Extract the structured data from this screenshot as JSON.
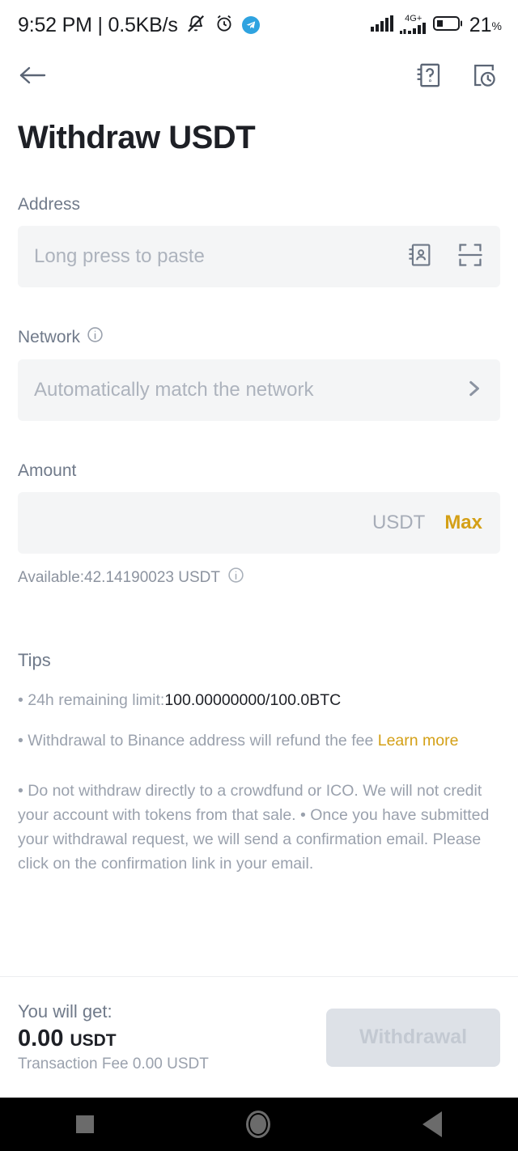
{
  "status_bar": {
    "clock_text": "9:52 PM | 0.5KB/s",
    "icons": [
      "mute-bell-icon",
      "alarm-clock-icon",
      "telegram-icon"
    ],
    "network_label": "4G+",
    "battery_percent": "21",
    "battery_percent_symbol": "%"
  },
  "nav_bar": {
    "back_icon": "back-arrow-icon",
    "help_icon": "help-book-icon",
    "history_icon": "withdraw-history-icon"
  },
  "header": {
    "title": "Withdraw USDT"
  },
  "address": {
    "label": "Address",
    "placeholder": "Long press to paste",
    "value": "",
    "contacts_icon": "address-book-icon",
    "scan_icon": "qr-scan-icon"
  },
  "network": {
    "label": "Network",
    "info_icon": "info-icon",
    "placeholder": "Automatically match the network",
    "value": "",
    "chevron_icon": "chevron-right-icon"
  },
  "amount": {
    "label": "Amount",
    "value": "",
    "unit": "USDT",
    "max_label": "Max",
    "available_text": "Available:42.14190023 USDT",
    "available_info_icon": "info-icon"
  },
  "tips": {
    "title": "Tips",
    "limit_prefix": "• 24h remaining limit:",
    "limit_value": "100.00000000/100.0BTC",
    "refund_text": "• Withdrawal to Binance address will refund the fee ",
    "refund_link": "Learn more",
    "paragraph": "• Do not withdraw directly to a crowdfund or ICO. We will not credit your account with tokens from that sale. • Once you have submitted your withdrawal request, we will send a confirmation email. Please click on the confirmation link in your email."
  },
  "bottom_bar": {
    "get_label": "You will get:",
    "get_amount": "0.00",
    "get_unit": "USDT",
    "fee_label": "Transaction Fee",
    "fee_value": "0.00 USDT",
    "withdraw_button": "Withdrawal"
  },
  "android_nav": {
    "recents_icon": "recents-square-icon",
    "home_icon": "home-circle-icon",
    "back_icon": "back-triangle-icon"
  },
  "colors": {
    "accent_gold": "#d4a017",
    "text_primary": "#1e2026",
    "text_secondary": "#707a8a",
    "field_bg": "#f4f5f6",
    "disabled_btn": "#dde1e7"
  }
}
